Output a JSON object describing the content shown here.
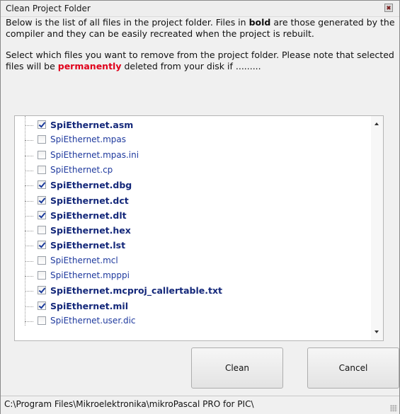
{
  "window": {
    "title": "Clean Project Folder"
  },
  "description": {
    "p1_part1": "Below is the list of all files in the project folder. Files in ",
    "p1_bold": "bold",
    "p1_part2": " are those generated by the compiler and they can be easily recreated when the project is rebuilt.",
    "p2_part1": "Select which files you want to remove from the project folder. Please note that selected files will be ",
    "p2_warn": "permanently",
    "p2_part2": " deleted from your disk if .........",
    "warn_color": "#e0001b"
  },
  "files": [
    {
      "name": "SpiEthernet.asm",
      "checked": true,
      "bold": true
    },
    {
      "name": "SpiEthernet.mpas",
      "checked": false,
      "bold": false
    },
    {
      "name": "SpiEthernet.mpas.ini",
      "checked": false,
      "bold": false
    },
    {
      "name": "SpiEthernet.cp",
      "checked": false,
      "bold": false
    },
    {
      "name": "SpiEthernet.dbg",
      "checked": true,
      "bold": true
    },
    {
      "name": "SpiEthernet.dct",
      "checked": true,
      "bold": true
    },
    {
      "name": "SpiEthernet.dlt",
      "checked": true,
      "bold": true
    },
    {
      "name": "SpiEthernet.hex",
      "checked": false,
      "bold": true
    },
    {
      "name": "SpiEthernet.lst",
      "checked": true,
      "bold": true
    },
    {
      "name": "SpiEthernet.mcl",
      "checked": false,
      "bold": false
    },
    {
      "name": "SpiEthernet.mpppi",
      "checked": false,
      "bold": false
    },
    {
      "name": "SpiEthernet.mcproj_callertable.txt",
      "checked": true,
      "bold": true
    },
    {
      "name": "SpiEthernet.mil",
      "checked": true,
      "bold": true
    },
    {
      "name": "SpiEthernet.user.dic",
      "checked": false,
      "bold": false
    }
  ],
  "buttons": {
    "clean": "Clean",
    "cancel": "Cancel"
  },
  "status": {
    "path": "C:\\Program Files\\Mikroelektronika\\mikroPascal PRO for PIC\\"
  }
}
